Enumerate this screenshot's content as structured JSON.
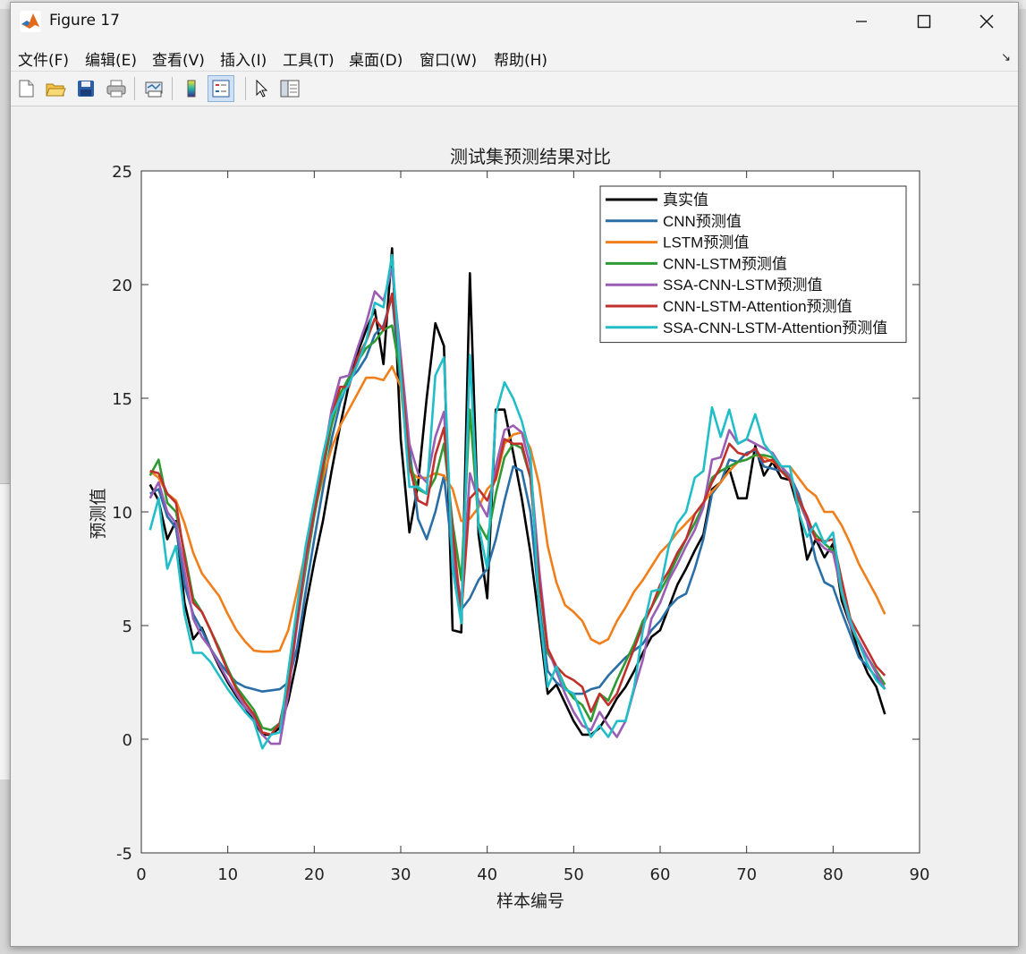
{
  "window": {
    "title": "Figure 17"
  },
  "menu": [
    {
      "label": "文件(F)",
      "key": "file"
    },
    {
      "label": "编辑(E)",
      "key": "edit"
    },
    {
      "label": "查看(V)",
      "key": "view"
    },
    {
      "label": "插入(I)",
      "key": "insert"
    },
    {
      "label": "工具(T)",
      "key": "tools"
    },
    {
      "label": "桌面(D)",
      "key": "desktop"
    },
    {
      "label": "窗口(W)",
      "key": "window"
    },
    {
      "label": "帮助(H)",
      "key": "help"
    }
  ],
  "toolbar": {
    "buttons": [
      {
        "name": "new-figure",
        "icon": "new-file-icon"
      },
      {
        "name": "open-file",
        "icon": "open-folder-icon"
      },
      {
        "name": "save-figure",
        "icon": "save-disk-icon"
      },
      {
        "name": "print-figure",
        "icon": "printer-icon"
      },
      {
        "name": "link-plot",
        "icon": "link-plot-icon"
      },
      {
        "name": "insert-colorbar",
        "icon": "colorbar-icon"
      },
      {
        "name": "insert-legend",
        "icon": "legend-icon",
        "active": true
      },
      {
        "name": "edit-plot",
        "icon": "pointer-arrow-icon"
      },
      {
        "name": "property-inspector",
        "icon": "property-panel-icon"
      }
    ]
  },
  "colors": {
    "true": "#000000",
    "cnn": "#2a6ea6",
    "lstm": "#f07f1b",
    "cnn_lstm": "#2e9a33",
    "ssa_cnn_lstm": "#9a5db4",
    "cnn_lstm_att": "#c0302c",
    "ssa_cnn_lstm_att": "#22bec8"
  },
  "chart_data": {
    "type": "line",
    "title": "测试集预测结果对比",
    "xlabel": "样本编号",
    "ylabel": "预测值",
    "xlim": [
      0,
      90
    ],
    "ylim": [
      -5,
      25
    ],
    "xticks": [
      0,
      10,
      20,
      30,
      40,
      50,
      60,
      70,
      80,
      90
    ],
    "yticks": [
      -5,
      0,
      5,
      10,
      15,
      20,
      25
    ],
    "grid": false,
    "legend_position": "top-right",
    "x": [
      1,
      2,
      3,
      4,
      5,
      6,
      7,
      8,
      9,
      10,
      11,
      12,
      13,
      14,
      15,
      16,
      17,
      18,
      19,
      20,
      21,
      22,
      23,
      24,
      25,
      26,
      27,
      28,
      29,
      30,
      31,
      32,
      33,
      34,
      35,
      36,
      37,
      38,
      39,
      40,
      41,
      42,
      43,
      44,
      45,
      46,
      47,
      48,
      49,
      50,
      51,
      52,
      53,
      54,
      55,
      56,
      57,
      58,
      59,
      60,
      61,
      62,
      63,
      64,
      65,
      66,
      67,
      68,
      69,
      70,
      71,
      72,
      73,
      74,
      75,
      76,
      77,
      78,
      79,
      80,
      81,
      82,
      83,
      84,
      85,
      86
    ],
    "series": [
      {
        "name": "真实值",
        "color_key": "true",
        "values": [
          11.2,
          10.5,
          8.8,
          9.6,
          6.0,
          4.4,
          4.9,
          4.0,
          3.2,
          2.5,
          1.9,
          1.4,
          0.8,
          0.2,
          0.2,
          0.5,
          1.7,
          3.5,
          5.8,
          7.8,
          9.6,
          11.8,
          13.8,
          15.6,
          17.0,
          18.0,
          18.9,
          16.5,
          21.6,
          13.2,
          9.1,
          11.2,
          15.0,
          18.3,
          17.3,
          4.8,
          4.7,
          20.5,
          9.0,
          6.2,
          14.5,
          14.5,
          12.6,
          10.6,
          8.2,
          5.2,
          2.0,
          2.4,
          1.6,
          0.8,
          0.2,
          0.2,
          0.5,
          1.1,
          1.8,
          2.3,
          3.0,
          3.8,
          4.5,
          4.8,
          5.8,
          6.8,
          7.5,
          8.3,
          9.0,
          11.0,
          11.3,
          11.9,
          10.6,
          10.6,
          12.9,
          11.6,
          12.2,
          11.5,
          11.4,
          10.1,
          7.9,
          8.8,
          8.0,
          8.6,
          6.1,
          5.0,
          3.8,
          2.9,
          2.3,
          1.1
        ]
      },
      {
        "name": "CNN预测值",
        "color_key": "cnn",
        "values": [
          10.8,
          11.0,
          9.8,
          9.3,
          6.8,
          5.5,
          4.8,
          4.0,
          3.4,
          2.9,
          2.5,
          2.3,
          2.2,
          2.1,
          2.15,
          2.2,
          2.5,
          4.0,
          6.5,
          8.8,
          11.0,
          13.2,
          14.8,
          15.8,
          16.2,
          16.8,
          17.8,
          18.2,
          19.5,
          15.5,
          12.8,
          9.7,
          8.8,
          10.0,
          11.6,
          8.0,
          5.7,
          6.2,
          7.0,
          7.5,
          8.8,
          10.5,
          12.0,
          11.8,
          10.0,
          6.0,
          3.0,
          2.5,
          2.2,
          2.0,
          2.0,
          2.2,
          2.3,
          2.8,
          3.2,
          3.6,
          3.9,
          4.2,
          4.8,
          5.2,
          5.8,
          6.2,
          6.4,
          7.5,
          8.8,
          10.8,
          11.3,
          12.3,
          12.2,
          12.6,
          12.7,
          12.0,
          11.9,
          11.8,
          11.6,
          10.8,
          9.6,
          7.9,
          6.9,
          6.7,
          5.6,
          4.6,
          3.6,
          3.2,
          2.7,
          2.2
        ]
      },
      {
        "name": "LSTM预测值",
        "color_key": "lstm",
        "values": [
          11.8,
          11.5,
          10.8,
          10.5,
          9.5,
          8.2,
          7.3,
          6.8,
          6.3,
          5.5,
          4.8,
          4.3,
          3.9,
          3.85,
          3.85,
          3.9,
          4.8,
          6.5,
          8.3,
          10.0,
          11.5,
          12.8,
          13.8,
          14.5,
          15.2,
          15.9,
          15.9,
          15.8,
          16.4,
          15.5,
          11.8,
          11.5,
          11.5,
          11.7,
          11.6,
          11.0,
          9.6,
          9.7,
          10.2,
          11.0,
          11.4,
          13.0,
          13.4,
          13.5,
          12.8,
          11.2,
          8.5,
          6.9,
          5.9,
          5.6,
          5.2,
          4.4,
          4.2,
          4.4,
          5.2,
          5.8,
          6.5,
          7.0,
          7.6,
          8.2,
          8.6,
          9.1,
          9.5,
          9.9,
          10.4,
          10.9,
          11.3,
          11.8,
          12.2,
          12.3,
          12.5,
          12.4,
          12.2,
          12.0,
          12.0,
          11.5,
          11.0,
          10.7,
          10.0,
          10.0,
          9.4,
          8.6,
          7.7,
          7.0,
          6.3,
          5.5
        ]
      },
      {
        "name": "CNN-LSTM预测值",
        "color_key": "cnn_lstm",
        "values": [
          11.6,
          12.3,
          10.4,
          10.0,
          8.2,
          6.2,
          5.6,
          4.8,
          4.0,
          3.1,
          2.3,
          1.8,
          1.3,
          0.5,
          0.4,
          0.7,
          2.5,
          5.0,
          7.5,
          9.8,
          11.8,
          13.8,
          15.2,
          15.9,
          16.6,
          17.2,
          17.5,
          18.0,
          18.2,
          16.0,
          12.2,
          11.0,
          10.8,
          11.5,
          13.0,
          9.5,
          7.0,
          14.5,
          9.5,
          8.8,
          10.8,
          12.4,
          13.0,
          12.8,
          11.5,
          7.0,
          3.8,
          3.2,
          2.3,
          1.8,
          1.5,
          0.8,
          2.0,
          1.7,
          2.6,
          3.4,
          4.2,
          5.2,
          5.8,
          6.5,
          7.2,
          8.0,
          8.8,
          9.5,
          10.3,
          11.5,
          11.8,
          12.0,
          12.2,
          12.3,
          12.5,
          12.5,
          12.4,
          12.0,
          11.5,
          10.5,
          9.6,
          9.0,
          8.6,
          8.3,
          6.4,
          5.0,
          4.2,
          3.6,
          3.0,
          2.4
        ]
      },
      {
        "name": "SSA-CNN-LSTM预测值",
        "color_key": "ssa_cnn_lstm",
        "values": [
          10.6,
          11.3,
          10.0,
          9.5,
          7.4,
          5.3,
          4.5,
          4.0,
          3.3,
          2.6,
          2.0,
          1.4,
          1.0,
          0.2,
          -0.2,
          -0.2,
          2.0,
          5.0,
          7.8,
          10.0,
          12.2,
          14.5,
          15.9,
          16.0,
          17.2,
          18.3,
          19.7,
          19.3,
          20.7,
          16.9,
          13.0,
          11.7,
          11.3,
          13.3,
          14.4,
          8.3,
          6.0,
          11.7,
          10.5,
          9.8,
          12.0,
          13.6,
          13.8,
          13.5,
          12.0,
          7.5,
          4.0,
          3.0,
          2.0,
          1.2,
          0.6,
          0.4,
          1.2,
          0.6,
          0.1,
          0.8,
          2.2,
          3.5,
          5.3,
          6.0,
          7.0,
          7.7,
          8.5,
          9.2,
          10.2,
          12.3,
          12.4,
          13.6,
          13.0,
          13.2,
          13.0,
          12.8,
          12.6,
          12.0,
          11.6,
          10.6,
          9.6,
          8.8,
          8.4,
          8.2,
          6.5,
          5.0,
          4.3,
          3.6,
          2.9,
          2.2
        ]
      },
      {
        "name": "CNN-LSTM-Attention预测值",
        "color_key": "cnn_lstm_att",
        "values": [
          11.8,
          11.7,
          10.8,
          10.4,
          8.0,
          6.0,
          5.6,
          4.8,
          3.9,
          3.0,
          2.2,
          1.6,
          1.1,
          0.3,
          0.2,
          0.7,
          2.3,
          5.2,
          8.0,
          10.0,
          12.0,
          14.2,
          15.5,
          15.5,
          16.8,
          17.5,
          18.5,
          18.0,
          19.6,
          16.5,
          12.0,
          10.5,
          10.3,
          12.5,
          13.7,
          9.2,
          5.5,
          10.6,
          11.0,
          10.5,
          11.5,
          13.2,
          13.0,
          13.0,
          11.5,
          7.0,
          4.0,
          3.2,
          2.8,
          2.6,
          2.3,
          1.2,
          2.0,
          1.5,
          2.0,
          3.0,
          4.0,
          5.0,
          5.8,
          6.8,
          7.4,
          8.2,
          8.8,
          9.9,
          10.4,
          11.3,
          12.0,
          13.0,
          12.6,
          12.5,
          12.8,
          12.2,
          12.3,
          11.8,
          11.4,
          10.6,
          9.8,
          8.8,
          8.7,
          8.8,
          7.0,
          5.3,
          4.6,
          3.9,
          3.2,
          2.8
        ]
      },
      {
        "name": "SSA-CNN-LSTM-Attention预测值",
        "color_key": "ssa_cnn_lstm_att",
        "values": [
          9.2,
          10.6,
          7.5,
          8.5,
          5.5,
          3.8,
          3.8,
          3.4,
          2.8,
          2.2,
          1.7,
          1.2,
          0.8,
          -0.4,
          0.2,
          0.3,
          3.0,
          5.8,
          8.5,
          10.5,
          12.5,
          14.2,
          15.0,
          15.6,
          16.5,
          17.5,
          19.2,
          19.0,
          21.3,
          16.0,
          11.1,
          11.1,
          10.8,
          16.0,
          16.8,
          7.5,
          5.1,
          16.9,
          9.4,
          7.5,
          14.3,
          15.7,
          15.0,
          14.0,
          12.5,
          5.7,
          2.3,
          3.2,
          2.2,
          2.0,
          1.0,
          0.1,
          0.6,
          0.1,
          0.8,
          0.8,
          2.3,
          4.8,
          6.5,
          6.6,
          8.5,
          9.5,
          10.0,
          11.5,
          11.8,
          14.6,
          13.3,
          14.5,
          13.0,
          13.2,
          14.3,
          13.0,
          12.5,
          12.0,
          12.0,
          10.0,
          8.9,
          9.5,
          8.6,
          9.1,
          6.5,
          5.2,
          4.2,
          3.3,
          2.6,
          2.2
        ]
      }
    ]
  }
}
